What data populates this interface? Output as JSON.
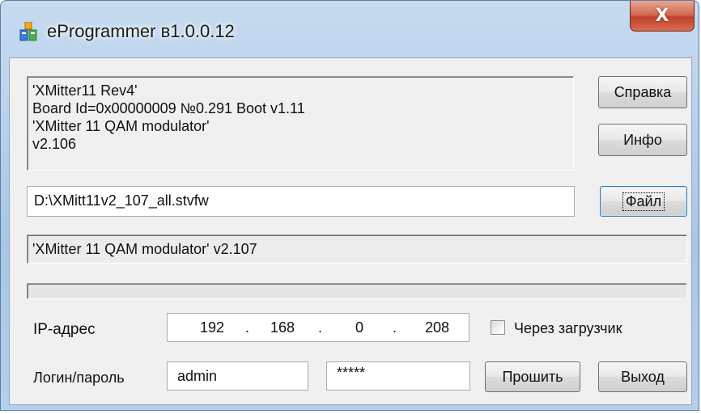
{
  "window": {
    "title": "eProgrammer в1.0.0.12",
    "close_glyph": "X"
  },
  "device_info": {
    "lines": [
      "'XMitter11 Rev4'",
      "Board Id=0x00000009 №0.291 Boot v1.11",
      "'XMitter 11 QAM modulator'",
      "v2.106"
    ]
  },
  "buttons": {
    "help": "Справка",
    "info": "Инфо",
    "file": "Файл",
    "flash": "Прошить",
    "exit": "Выход"
  },
  "file_path": "D:\\XMitt11v2_107_all.stvfw",
  "firmware_info": "'XMitter 11 QAM modulator' v2.107",
  "progress": {
    "value": 0
  },
  "ip": {
    "label": "IP-адрес",
    "octets": [
      "192",
      "168",
      "0",
      "208"
    ],
    "separator": "."
  },
  "bootloader": {
    "label": "Через загрузчик",
    "checked": false
  },
  "login": {
    "label": "Логин/пароль",
    "username": "admin",
    "password": "*****"
  },
  "icons": {
    "app": "app-icon",
    "close": "close-icon"
  },
  "colors": {
    "titlebar": "#b5cfeb",
    "close": "#c7442c",
    "client": "#f0f0f0"
  }
}
